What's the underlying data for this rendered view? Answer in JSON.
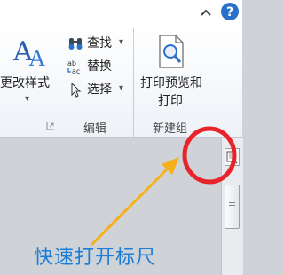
{
  "titlebar": {
    "minimize_icon": "caret-up-icon",
    "help_icon": "help-icon",
    "help_glyph": "?"
  },
  "ribbon": {
    "styles_group": {
      "change_styles_label": "更改样式",
      "launcher_icon": "dialog-launcher-icon"
    },
    "editing_group": {
      "find_label": "查找",
      "replace_label": "替换",
      "select_label": "选择",
      "group_label": "编辑",
      "replace_icon_text_top": "ab",
      "replace_icon_text_bottom": "ac"
    },
    "new_group": {
      "print_preview_line1": "打印预览和",
      "print_preview_line2": "打印",
      "group_label": "新建组"
    }
  },
  "document": {
    "ruler_button_icon": "view-ruler-icon"
  },
  "annotation": {
    "text": "快速打开标尺",
    "circle_color": "#e8242a",
    "arrow_color": "#f5b01a",
    "text_color": "#1c7ed6"
  }
}
